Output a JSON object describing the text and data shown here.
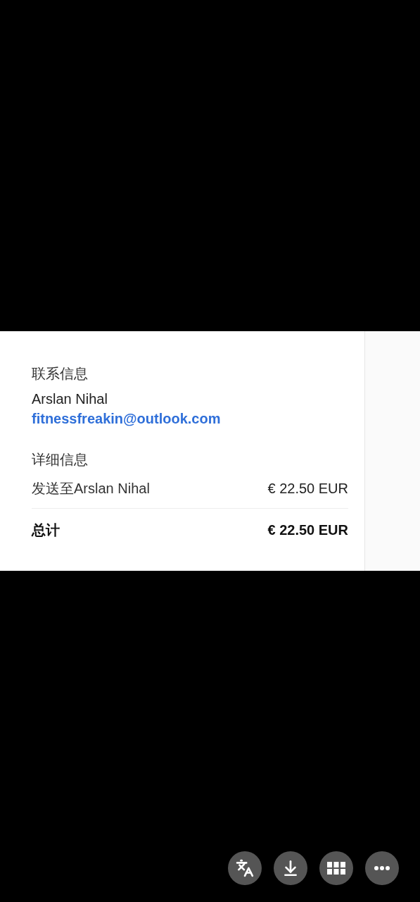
{
  "receipt": {
    "contact_heading": "联系信息",
    "contact_name": "Arslan Nihal",
    "contact_email": "fitnessfreakin@outlook.com",
    "details_heading": "详细信息",
    "line_items": [
      {
        "label": "发送至Arslan Nihal",
        "amount": "€ 22.50 EUR"
      }
    ],
    "total": {
      "label": "总计",
      "amount": "€ 22.50 EUR"
    }
  },
  "toolbar": [
    {
      "kind": "translate"
    },
    {
      "kind": "download"
    },
    {
      "kind": "grid"
    },
    {
      "kind": "more"
    }
  ]
}
